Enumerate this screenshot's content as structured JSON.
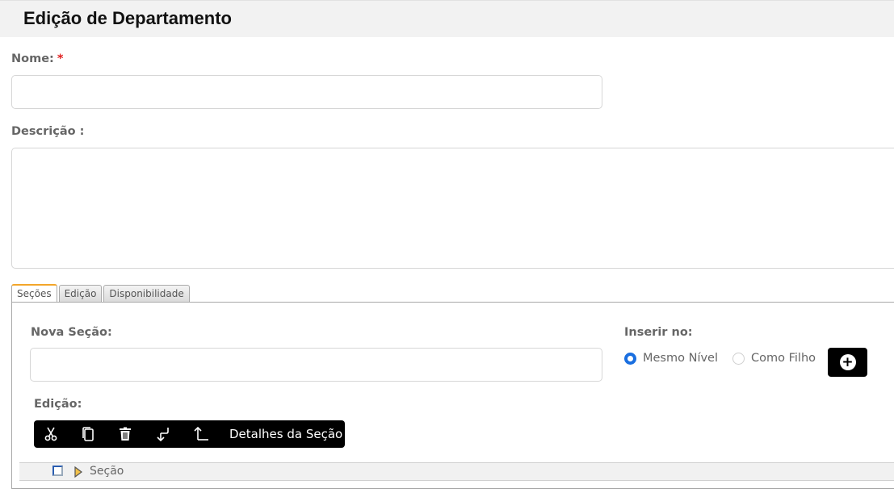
{
  "page": {
    "title": "Edição de Departamento"
  },
  "form": {
    "name_label": "Nome:",
    "required_mark": "*",
    "name_value": "",
    "description_label": "Descrição :",
    "description_value": ""
  },
  "tabs": [
    {
      "label": "Seções",
      "active": true
    },
    {
      "label": "Edição",
      "active": false
    },
    {
      "label": "Disponibilidade",
      "active": false
    }
  ],
  "sections": {
    "new_section_label": "Nova Seção:",
    "new_section_value": "",
    "insert_label": "Inserir no:",
    "insert_options": [
      {
        "label": "Mesmo Nível",
        "checked": true
      },
      {
        "label": "Como Filho",
        "checked": false
      }
    ],
    "add_icon": "plus-circle-icon",
    "edit_label": "Edição:",
    "toolbar": {
      "icons": [
        "scissors-icon",
        "copy-icon",
        "trash-icon",
        "move-down-icon",
        "move-up-icon"
      ],
      "details_label": "Detalhes da Seção"
    },
    "tree": {
      "root_label": "Seção",
      "accent_color": "#f3a62a",
      "checkbox_color": "#2a5db0"
    }
  },
  "colors": {
    "header_bg": "#f2f2f2",
    "radio_checked": "#1a6fe0",
    "required": "#e02020",
    "tab_active_border": "#f3a62a"
  }
}
